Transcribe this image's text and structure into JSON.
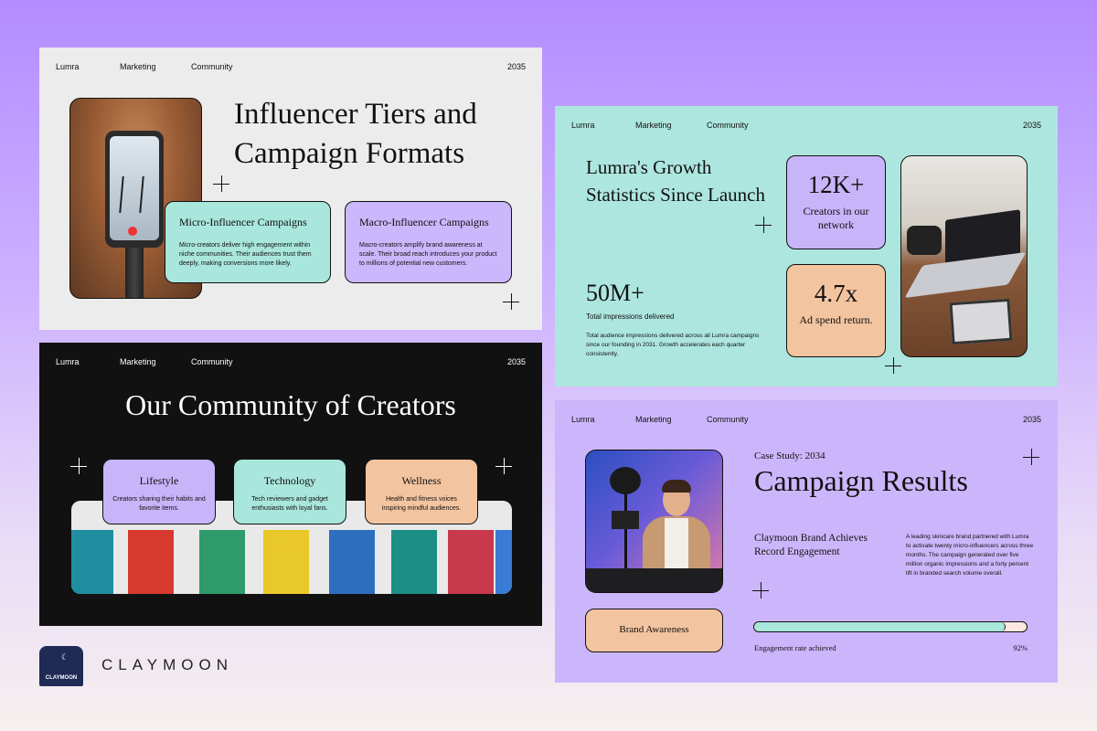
{
  "nav": {
    "brand": "Lumra",
    "marketing": "Marketing",
    "community": "Community",
    "year": "2035"
  },
  "slide1": {
    "title": "Influencer Tiers and Campaign Formats",
    "card1": {
      "title": "Micro-Influencer Campaigns",
      "desc": "Micro-creators deliver high engagement within niche communities. Their audiences trust them deeply, making conversions more likely."
    },
    "card2": {
      "title": "Macro-Influencer Campaigns",
      "desc": "Macro-creators amplify brand awareness at scale. Their broad reach introduces your product to millions of potential new customers."
    }
  },
  "slide2": {
    "title": "Lumra's Growth Statistics Since Launch",
    "impressions": {
      "value": "50M+",
      "label": "Total impressions delivered",
      "desc": "Total audience impressions delivered across all Lumra campaigns since our founding in 2031. Growth accelerates each quarter consistently."
    },
    "stat1": {
      "value": "12K+",
      "label": "Creators in our network"
    },
    "stat2": {
      "value": "4.7x",
      "label": "Ad spend return."
    }
  },
  "slide3": {
    "title": "Our Community of Creators",
    "categories": [
      {
        "title": "Lifestyle",
        "desc": "Creators sharing their habits and favorite items."
      },
      {
        "title": "Technology",
        "desc": "Tech reviewers and gadget enthusiasts with loyal fans."
      },
      {
        "title": "Wellness",
        "desc": "Health and fitness voices inspiring mindful audiences."
      }
    ]
  },
  "slide4": {
    "case": "Case Study: 2034",
    "title": "Campaign Results",
    "subtitle": "Claymoon Brand Achieves Record Engagement",
    "desc": "A leading skincare brand partnered with Lumra to activate twenty micro-influencers across three months. The campaign generated over five million organic impressions and a forty percent lift in branded search volume overall.",
    "tag": "Brand Awareness",
    "progress": {
      "label": "Engagement rate achieved",
      "value_text": "92%",
      "value": 0.92
    }
  },
  "logo": {
    "badge_text": "CLAYMOON",
    "brand_text": "CLAYMOON"
  },
  "colors": {
    "lavender": "#cbb7fb",
    "mint": "#a9e6dc",
    "peach": "#f3c4a0",
    "dark": "#111111"
  }
}
